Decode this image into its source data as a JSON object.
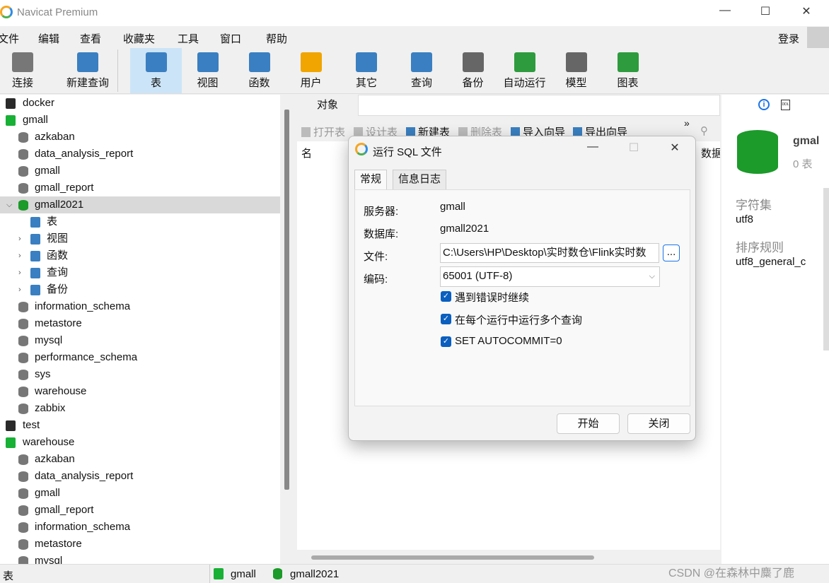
{
  "app": {
    "title": "Navicat Premium",
    "login": "登录"
  },
  "menu": [
    "文件",
    "编辑",
    "查看",
    "收藏夹",
    "工具",
    "窗口",
    "帮助"
  ],
  "toolbar": [
    {
      "label": "连接",
      "icon": "plug-icon",
      "color": "#777"
    },
    {
      "label": "新建查询",
      "icon": "new-query-icon",
      "color": "#3a7fc1"
    },
    {
      "label": "表",
      "icon": "table-icon",
      "color": "#3a7fc1",
      "active": true
    },
    {
      "label": "视图",
      "icon": "view-icon",
      "color": "#3a7fc1"
    },
    {
      "label": "函数",
      "icon": "function-icon",
      "color": "#3a7fc1"
    },
    {
      "label": "用户",
      "icon": "user-icon",
      "color": "#f0a500"
    },
    {
      "label": "其它",
      "icon": "tools-icon",
      "color": "#3a7fc1"
    },
    {
      "label": "查询",
      "icon": "query-icon",
      "color": "#3a7fc1"
    },
    {
      "label": "备份",
      "icon": "backup-icon",
      "color": "#666"
    },
    {
      "label": "自动运行",
      "icon": "schedule-icon",
      "color": "#2e9b3e"
    },
    {
      "label": "模型",
      "icon": "model-icon",
      "color": "#666"
    },
    {
      "label": "图表",
      "icon": "chart-icon",
      "color": "#2e9b3e"
    }
  ],
  "tree": [
    {
      "label": "docker",
      "level": 0,
      "type": "server"
    },
    {
      "label": "gmall",
      "level": 0,
      "type": "server-open"
    },
    {
      "label": "azkaban",
      "level": 1,
      "type": "db"
    },
    {
      "label": "data_analysis_report",
      "level": 1,
      "type": "db"
    },
    {
      "label": "gmall",
      "level": 1,
      "type": "db"
    },
    {
      "label": "gmall_report",
      "level": 1,
      "type": "db"
    },
    {
      "label": "gmall2021",
      "level": 1,
      "type": "db-open",
      "selected": true
    },
    {
      "label": "表",
      "level": 2,
      "type": "table"
    },
    {
      "label": "视图",
      "level": 2,
      "type": "view"
    },
    {
      "label": "函数",
      "level": 2,
      "type": "function"
    },
    {
      "label": "查询",
      "level": 2,
      "type": "query"
    },
    {
      "label": "备份",
      "level": 2,
      "type": "backup"
    },
    {
      "label": "information_schema",
      "level": 1,
      "type": "db"
    },
    {
      "label": "metastore",
      "level": 1,
      "type": "db"
    },
    {
      "label": "mysql",
      "level": 1,
      "type": "db"
    },
    {
      "label": "performance_schema",
      "level": 1,
      "type": "db"
    },
    {
      "label": "sys",
      "level": 1,
      "type": "db"
    },
    {
      "label": "warehouse",
      "level": 1,
      "type": "db"
    },
    {
      "label": "zabbix",
      "level": 1,
      "type": "db"
    },
    {
      "label": "test",
      "level": 0,
      "type": "server"
    },
    {
      "label": "warehouse",
      "level": 0,
      "type": "server-open"
    },
    {
      "label": "azkaban",
      "level": 1,
      "type": "db"
    },
    {
      "label": "data_analysis_report",
      "level": 1,
      "type": "db"
    },
    {
      "label": "gmall",
      "level": 1,
      "type": "db"
    },
    {
      "label": "gmall_report",
      "level": 1,
      "type": "db"
    },
    {
      "label": "information_schema",
      "level": 1,
      "type": "db"
    },
    {
      "label": "metastore",
      "level": 1,
      "type": "db"
    },
    {
      "label": "mysql",
      "level": 1,
      "type": "db"
    }
  ],
  "objects": {
    "tab": "对象",
    "actions": [
      "打开表",
      "设计表",
      "新建表",
      "删除表",
      "导入向导",
      "导出向导"
    ],
    "col_name": "名",
    "col_data": "数据"
  },
  "info": {
    "name": "gmal",
    "tables": "0 表",
    "charset_label": "字符集",
    "charset": "utf8",
    "collation_label": "排序规则",
    "collation": "utf8_general_c"
  },
  "status": {
    "left": "表",
    "server": "gmall",
    "database": "gmall2021"
  },
  "dialog": {
    "title": "运行 SQL 文件",
    "tabs": [
      "常规",
      "信息日志"
    ],
    "server_label": "服务器:",
    "server": "gmall",
    "db_label": "数据库:",
    "db": "gmall2021",
    "file_label": "文件:",
    "file": "C:\\Users\\HP\\Desktop\\实时数仓\\Flink实时数",
    "browse": "...",
    "encoding_label": "编码:",
    "encoding": "65001 (UTF-8)",
    "options": [
      {
        "label": "遇到错误时继续",
        "checked": true
      },
      {
        "label": "在每个运行中运行多个查询",
        "checked": true
      },
      {
        "label": "SET AUTOCOMMIT=0",
        "checked": true
      }
    ],
    "start": "开始",
    "close": "关闭"
  },
  "watermark": "CSDN @在森林中麋了鹿"
}
